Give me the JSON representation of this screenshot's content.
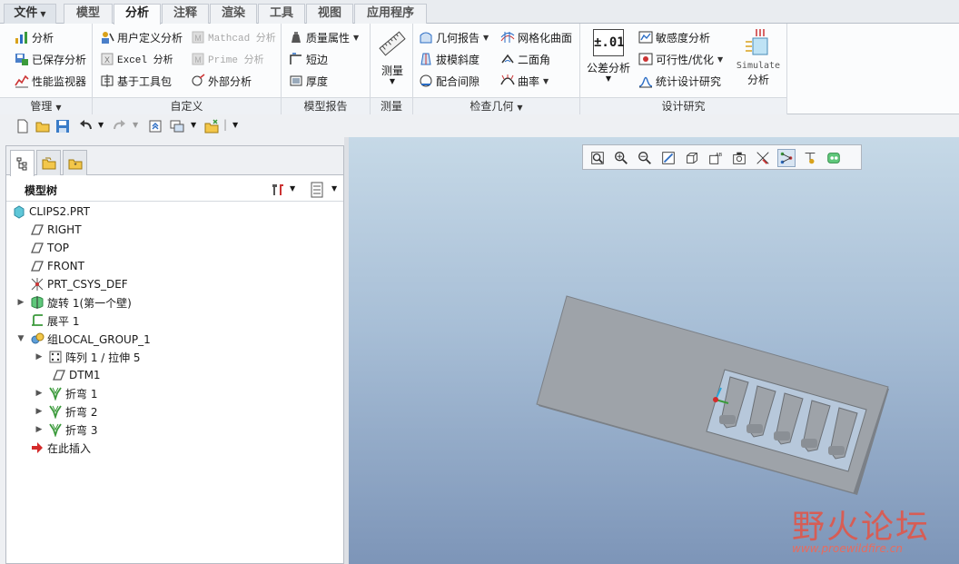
{
  "menu": {
    "file": "文件",
    "tabs": [
      "模型",
      "分析",
      "注释",
      "渲染",
      "工具",
      "视图",
      "应用程序"
    ],
    "active_index": 1
  },
  "ribbon": {
    "manage": {
      "label": "管理",
      "items": [
        "分析",
        "已保存分析",
        "性能监视器"
      ]
    },
    "custom": {
      "label": "自定义",
      "items": [
        "用户定义分析",
        "Excel 分析",
        "基于工具包",
        "Mathcad 分析",
        "Prime 分析",
        "外部分析"
      ]
    },
    "model_report": {
      "label": "模型报告",
      "items": [
        "质量属性",
        "短边",
        "厚度"
      ]
    },
    "measure": {
      "label": "测量",
      "button": "测量"
    },
    "inspect": {
      "label": "检查几何",
      "items": [
        "几何报告",
        "拔模斜度",
        "配合间隙",
        "网格化曲面",
        "二面角",
        "曲率"
      ]
    },
    "design_study": {
      "label": "设计研究",
      "tolerance_value": "±.01",
      "tolerance_label": "公差分析",
      "items": [
        "敏感度分析",
        "可行性/优化",
        "统计设计研究"
      ],
      "simulate_line1": "Simulate",
      "simulate_line2": "分析"
    }
  },
  "model_tree": {
    "title": "模型树",
    "items": [
      {
        "label": "CLIPS2.PRT"
      },
      {
        "label": "RIGHT"
      },
      {
        "label": "TOP"
      },
      {
        "label": "FRONT"
      },
      {
        "label": "PRT_CSYS_DEF"
      },
      {
        "label": "旋转 1(第一个壁)"
      },
      {
        "label": "展平 1"
      },
      {
        "label": "组LOCAL_GROUP_1"
      },
      {
        "label": "阵列 1 / 拉伸 5"
      },
      {
        "label": "DTM1"
      },
      {
        "label": "折弯 1"
      },
      {
        "label": "折弯 2"
      },
      {
        "label": "折弯 3"
      },
      {
        "label": "在此插入"
      }
    ]
  },
  "watermark": {
    "text": "野火论坛",
    "url": "www.proewildfire.cn"
  },
  "colors": {
    "accent": "#2a6cc4",
    "viewport_top": "#c6d9e7",
    "viewport_bottom": "#7d95b8",
    "part": "#9a9fa4",
    "watermark": "#e0574a"
  }
}
